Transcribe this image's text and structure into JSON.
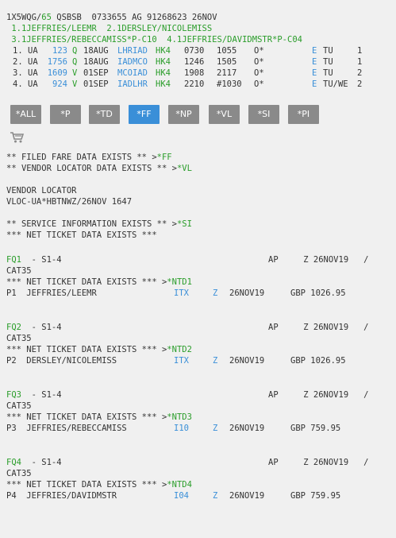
{
  "header": {
    "pnr_line": [
      "1X5WQG/",
      "65",
      " QSBSB  0733655 AG 91268623 26NOV"
    ],
    "names_line1": " 1.1JEFFRIES/LEEMR  2.1DERSLEY/NICOLEMISS",
    "names_line2": " 3.1JEFFRIES/REBECCAMISS*P-C10  4.1JEFFRIES/DAVIDMSTR*P-C04"
  },
  "segments": [
    {
      "num": "1.",
      "air": "UA",
      "flt": "123",
      "cls": "Q",
      "date": "18AUG",
      "city": "LHRIAD",
      "st": "HK4",
      "dep": "0730",
      "arr": "1055",
      "rest": "O*",
      "e": "E",
      "day": "TU",
      "cnt": "1"
    },
    {
      "num": "2.",
      "air": "UA",
      "flt": "1756",
      "cls": "Q",
      "date": "18AUG",
      "city": "IADMCO",
      "st": "HK4",
      "dep": "1246",
      "arr": "1505",
      "rest": "O*",
      "e": "E",
      "day": "TU",
      "cnt": "1"
    },
    {
      "num": "3.",
      "air": "UA",
      "flt": "1609",
      "cls": "V",
      "date": "01SEP",
      "city": "MCOIAD",
      "st": "HK4",
      "dep": "1908",
      "arr": "2117",
      "rest": "O*",
      "e": "E",
      "day": "TU",
      "cnt": "2"
    },
    {
      "num": "4.",
      "air": "UA",
      "flt": "924",
      "cls": "V",
      "date": "01SEP",
      "city": "IADLHR",
      "st": "HK4",
      "dep": "2210",
      "arr": "#1030",
      "rest": "O*",
      "e": "E",
      "day": "TU/WE",
      "cnt": "2"
    }
  ],
  "buttons": [
    "*ALL",
    "*P",
    "*TD",
    "*FF",
    "*NP",
    "*VL",
    "*SI",
    "*PI"
  ],
  "active_button": "*FF",
  "info": {
    "ff_text": "** FILED FARE DATA EXISTS ** >",
    "ff_link": "*FF",
    "vl_text": "** VENDOR LOCATOR DATA EXISTS ** >",
    "vl_link": "*VL",
    "vendor_title": "VENDOR LOCATOR",
    "vendor_line": "VLOC-UA*HBTNWZ/26NOV 1647",
    "si_text": "** SERVICE INFORMATION EXISTS ** >",
    "si_link": "*SI",
    "net_ticket": "*** NET TICKET DATA EXISTS ***"
  },
  "fares": [
    {
      "fq": "FQ1",
      "seg": "  - S1-4",
      "ap": "AP     Z 26NOV19   /",
      "cat": "CAT35",
      "net": "*** NET TICKET DATA EXISTS *** >",
      "ntd": "*NTD1",
      "p": "P1  JEFFRIES/LEEMR",
      "code": "ITX",
      "z": "Z",
      "date": "26NOV19",
      "amt": "GBP 1026.95"
    },
    {
      "fq": "FQ2",
      "seg": "  - S1-4",
      "ap": "AP     Z 26NOV19   /",
      "cat": "CAT35",
      "net": "*** NET TICKET DATA EXISTS *** >",
      "ntd": "*NTD2",
      "p": "P2  DERSLEY/NICOLEMISS",
      "code": "ITX",
      "z": "Z",
      "date": "26NOV19",
      "amt": "GBP 1026.95"
    },
    {
      "fq": "FQ3",
      "seg": "  - S1-4",
      "ap": "AP     Z 26NOV19   /",
      "cat": "CAT35",
      "net": "*** NET TICKET DATA EXISTS *** >",
      "ntd": "*NTD3",
      "p": "P3  JEFFRIES/REBECCAMISS",
      "code": "I10",
      "z": "Z",
      "date": "26NOV19",
      "amt": "GBP 759.95"
    },
    {
      "fq": "FQ4",
      "seg": "  - S1-4",
      "ap": "AP     Z 26NOV19   /",
      "cat": "CAT35",
      "net": "*** NET TICKET DATA EXISTS *** >",
      "ntd": "*NTD4",
      "p": "P4  JEFFRIES/DAVIDMSTR",
      "code": "I04",
      "z": "Z",
      "date": "26NOV19",
      "amt": "GBP 759.95"
    }
  ]
}
